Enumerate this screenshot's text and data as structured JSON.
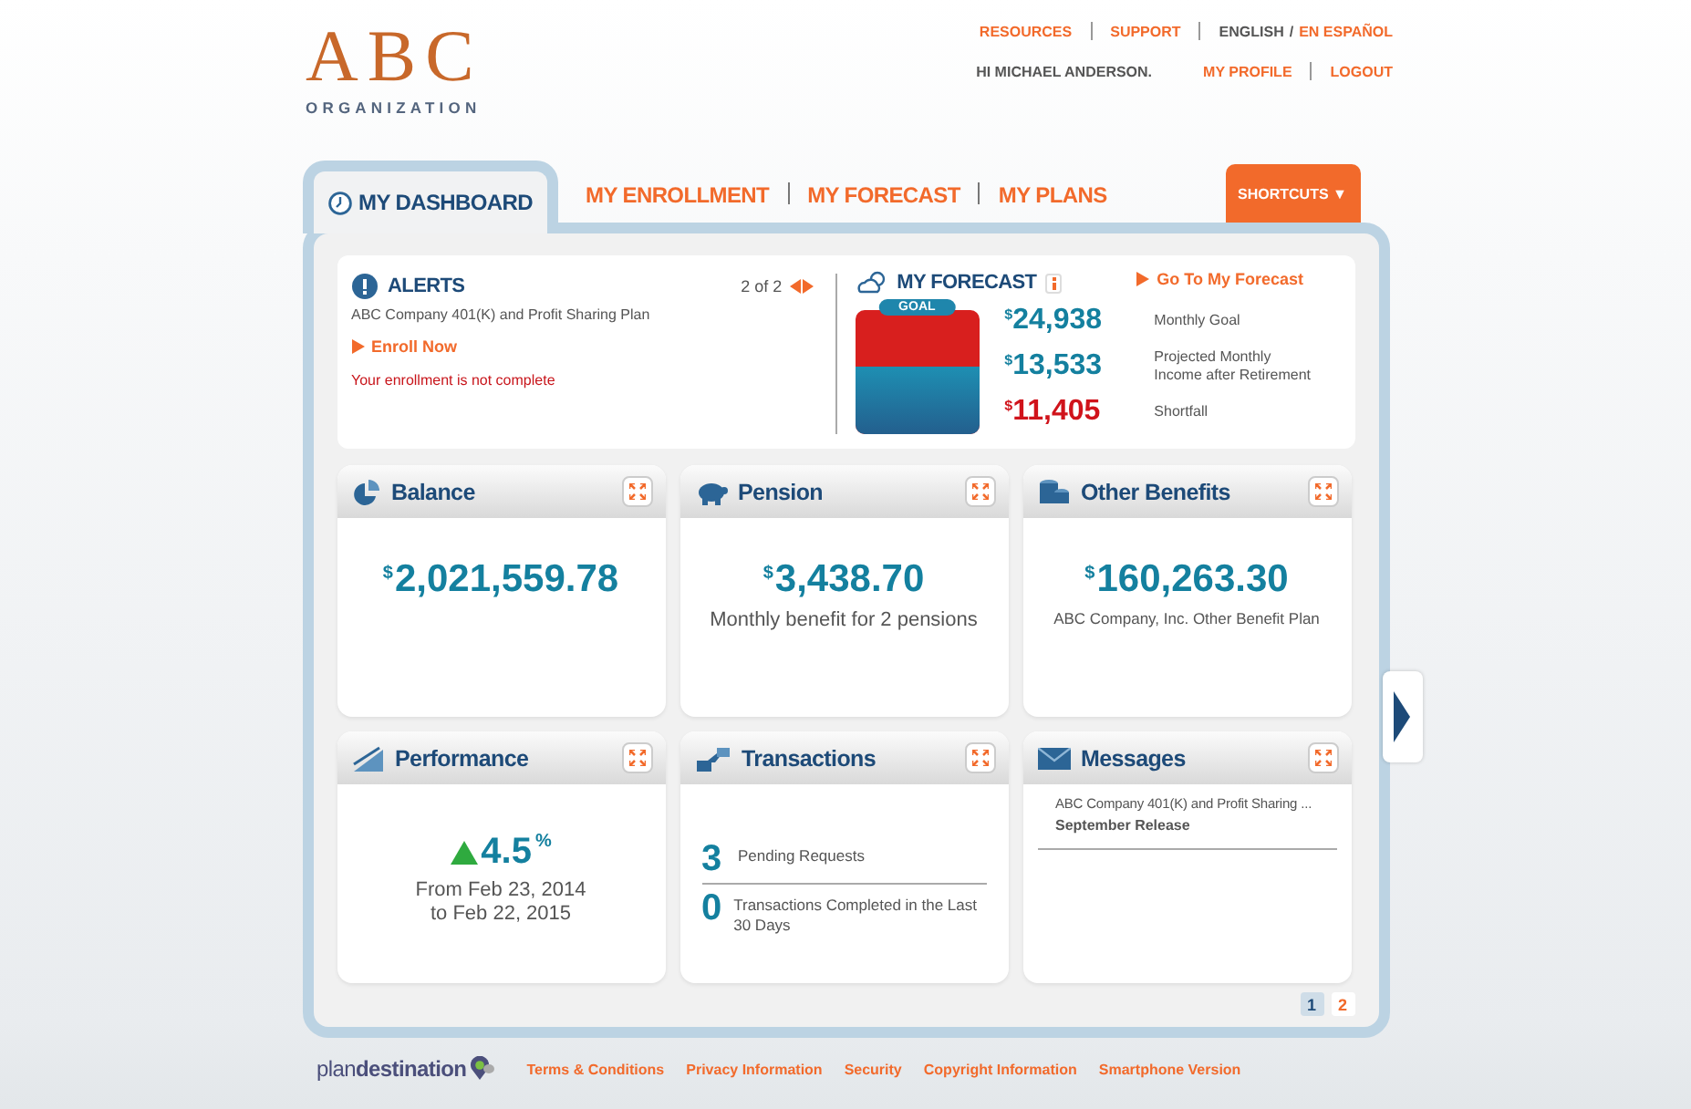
{
  "header": {
    "logo": {
      "name": "ABC",
      "subtitle": "ORGANIZATION"
    },
    "top_links": [
      "RESOURCES",
      "SUPPORT"
    ],
    "language_separator": "/",
    "languages": [
      {
        "label": "ENGLISH",
        "selected": true
      },
      {
        "label": "EN ESPAÑOL",
        "selected": false
      }
    ],
    "greeting": "HI MICHAEL ANDERSON.",
    "user_links": [
      "MY PROFILE",
      "LOGOUT"
    ]
  },
  "tabs": [
    {
      "label": "MY DASHBOARD",
      "selected": true
    },
    {
      "label": "MY ENROLLMENT",
      "selected": false
    },
    {
      "label": "MY FORECAST",
      "selected": false
    },
    {
      "label": "MY PLANS",
      "selected": false
    }
  ],
  "shortcuts": "SHORTCUTS ▼",
  "alerts": {
    "title": "ALERTS",
    "pager": "2 of 2",
    "plan": "ABC Company 401(K) and Profit Sharing Plan",
    "action": "Enroll Now",
    "message": "Your enrollment is not complete"
  },
  "forecast": {
    "title": "MY FORECAST",
    "link": "Go To My Forecast",
    "goal_label": "GOAL",
    "level": 0.54,
    "rows": [
      {
        "kind": "goal",
        "currency": "$",
        "amount": "24,938",
        "label": "Monthly Goal"
      },
      {
        "kind": "projected",
        "currency": "$",
        "amount": "13,533",
        "label": "Projected Monthly Income after Retirement"
      },
      {
        "kind": "shortfall",
        "currency": "$",
        "amount": "11,405",
        "label": "Shortfall"
      }
    ]
  },
  "cards": [
    {
      "kind": "amount",
      "title": "Balance",
      "currency": "$",
      "value": "2,021,559.78"
    },
    {
      "kind": "amount",
      "title": "Pension",
      "currency": "$",
      "value": "3,438.70",
      "note": "Monthly benefit for 2 pensions"
    },
    {
      "kind": "amount",
      "title": "Other Benefits",
      "currency": "$",
      "value": "160,263.30",
      "note": "ABC Company, Inc. Other Benefit Plan",
      "small_note": true
    },
    {
      "kind": "performance",
      "title": "Performance",
      "trend_up": true,
      "value": "4.5",
      "unit": "%",
      "period": "From Feb 23, 2014\nto Feb 22, 2015"
    },
    {
      "kind": "counts",
      "title": "Transactions",
      "items": [
        {
          "count": "3",
          "label": "Pending Requests"
        },
        {
          "count": "0",
          "label": "Transactions Completed in the Last 30 Days"
        }
      ]
    },
    {
      "kind": "messages",
      "title": "Messages",
      "items": [
        {
          "subject": "ABC Company 401(K) and Profit Sharing ...",
          "title": "September Release"
        }
      ]
    }
  ],
  "pages": [
    {
      "label": "1",
      "selected": true
    },
    {
      "label": "2",
      "selected": false
    }
  ],
  "footer": {
    "logo": "plan**destination**",
    "links": [
      "Terms & Conditions",
      "Privacy Information",
      "Security",
      "Copyright Information",
      "Smartphone Version"
    ]
  }
}
